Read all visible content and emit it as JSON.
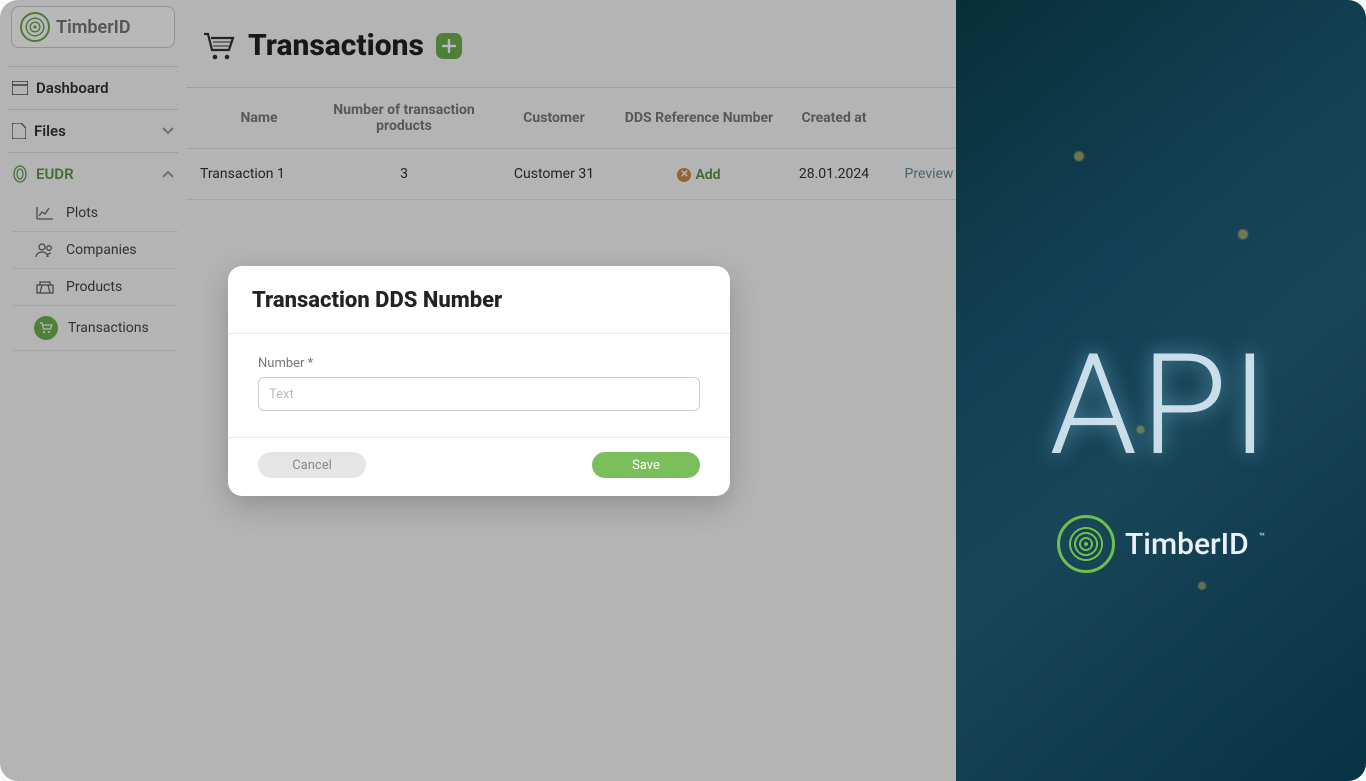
{
  "brand": {
    "name": "TimberID"
  },
  "sidebar": {
    "dashboard": "Dashboard",
    "files": "Files",
    "eudr": "EUDR",
    "sub": {
      "plots": "Plots",
      "companies": "Companies",
      "products": "Products",
      "transactions": "Transactions"
    }
  },
  "page": {
    "title": "Transactions",
    "columns": {
      "name": "Name",
      "count": "Number of transaction products",
      "customer": "Customer",
      "dds": "DDS Reference Number",
      "created": "Created at"
    },
    "rows": [
      {
        "name": "Transaction 1",
        "count": "3",
        "customer": "Customer 31",
        "add_label": "Add",
        "created": "28.01.2024",
        "preview": "Preview"
      }
    ]
  },
  "modal": {
    "title": "Transaction DDS Number",
    "field_label": "Number *",
    "placeholder": "Text",
    "cancel": "Cancel",
    "save": "Save"
  },
  "promo": {
    "api": "API",
    "brand": "TimberID",
    "tm": "™"
  }
}
